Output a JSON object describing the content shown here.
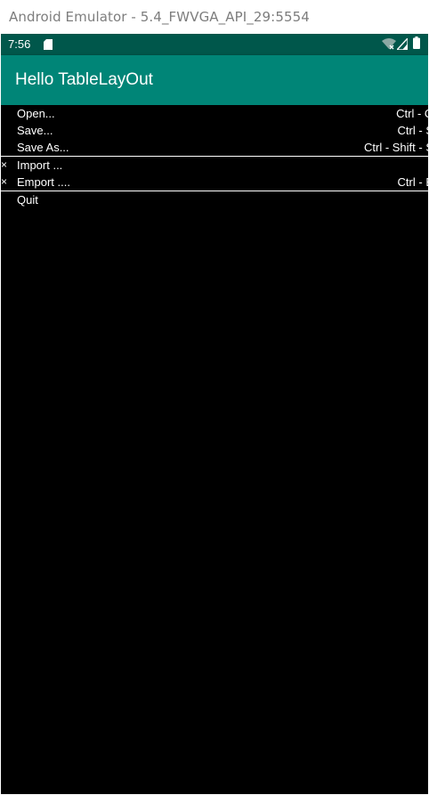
{
  "window": {
    "title": "Android Emulator - 5.4_FWVGA_API_29:5554"
  },
  "status_bar": {
    "time": "7:56",
    "icons": [
      "sd-card-icon",
      "wifi-icon",
      "signal-icon",
      "battery-icon"
    ]
  },
  "app_bar": {
    "title": "Hello TableLayOut",
    "color": "#008577"
  },
  "menu": {
    "rows": [
      {
        "mark": "",
        "label": "Open...",
        "shortcut": "Ctrl - O"
      },
      {
        "mark": "",
        "label": "Save...",
        "shortcut": "Ctrl - S"
      },
      {
        "mark": "",
        "label": "Save As...",
        "shortcut": "Ctrl - Shift - S"
      },
      {
        "mark": "×",
        "label": "Import ...",
        "shortcut": ""
      },
      {
        "mark": "×",
        "label": "Emport ....",
        "shortcut": "Ctrl - E"
      },
      {
        "mark": "",
        "label": "Quit",
        "shortcut": ""
      }
    ]
  },
  "colors": {
    "status_bar": "#00574b",
    "background": "#000000",
    "text": "#ffffff"
  }
}
